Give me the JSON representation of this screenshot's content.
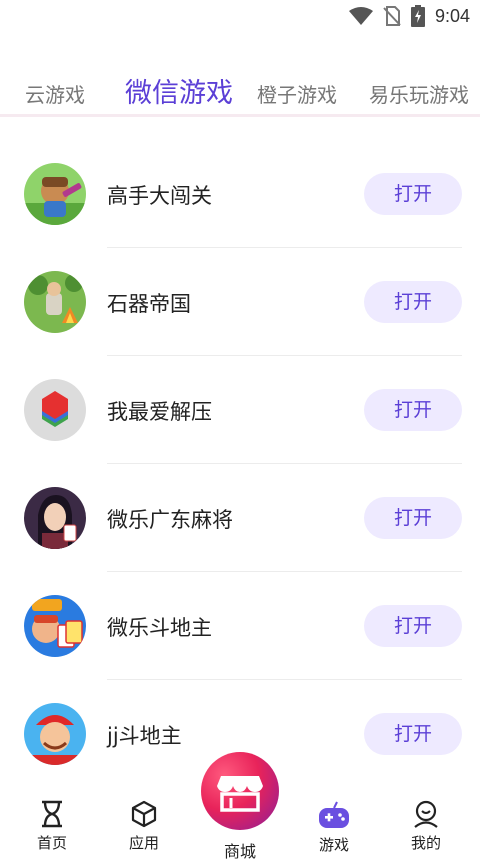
{
  "status_bar": {
    "time": "9:04"
  },
  "tabs": [
    {
      "label": "云游戏",
      "active": false
    },
    {
      "label": "微信游戏",
      "active": true
    },
    {
      "label": "橙子游戏",
      "active": false
    },
    {
      "label": "易乐玩游戏",
      "active": false
    }
  ],
  "games": [
    {
      "name": "高手大闯关",
      "button": "打开",
      "icon": "adventure-hero-icon"
    },
    {
      "name": "石器帝国",
      "button": "打开",
      "icon": "stone-age-icon"
    },
    {
      "name": "我最爱解压",
      "button": "打开",
      "icon": "color-cube-icon"
    },
    {
      "name": "微乐广东麻将",
      "button": "打开",
      "icon": "mahjong-girl-icon"
    },
    {
      "name": "微乐斗地主",
      "button": "打开",
      "icon": "landlord-cards-icon"
    },
    {
      "name": "jj斗地主",
      "button": "打开",
      "icon": "jj-landlord-icon"
    }
  ],
  "bottom_nav": {
    "home": "首页",
    "apps": "应用",
    "mall": "商城",
    "games": "游戏",
    "mine": "我的"
  },
  "colors": {
    "accent": "#5b3fd6",
    "button_bg": "#eeeaff",
    "mall_gradient": "#e8235a"
  }
}
